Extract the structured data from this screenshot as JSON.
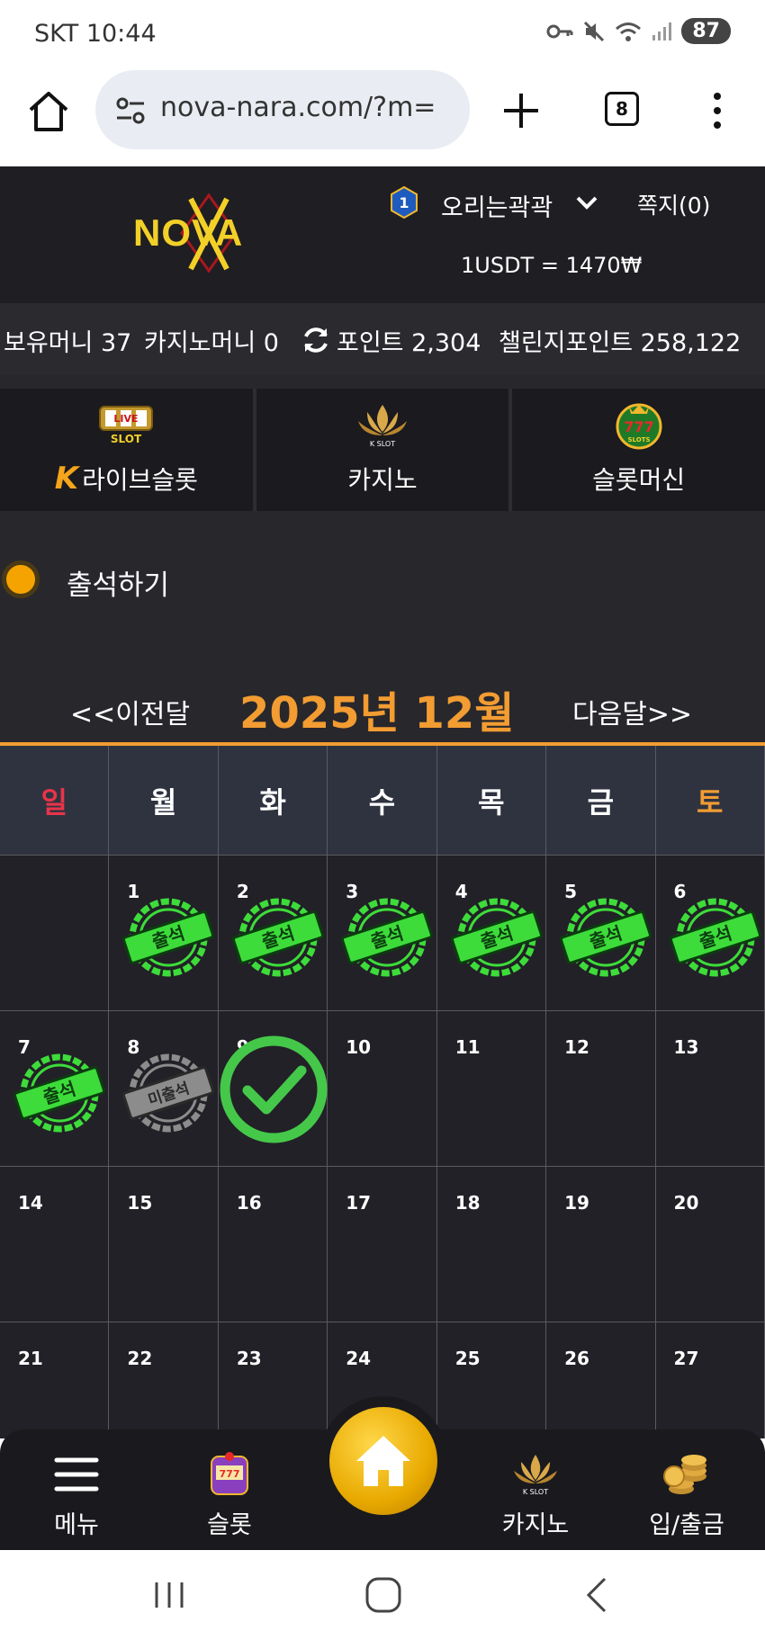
{
  "status_bar": {
    "carrier_time": "SKT 10:44",
    "battery": "87"
  },
  "browser": {
    "url": "nova-nara.com/?m=",
    "tab_count": "8"
  },
  "header": {
    "logo_text": "NOVA",
    "level": "1",
    "username": "오리는곽곽",
    "messages": "쪽지(0)",
    "rate": "1USDT = 1470₩"
  },
  "money": {
    "holding": "보유머니 37",
    "casino": "카지노머니 0",
    "points": "포인트 2,304",
    "challenge": "챌린지포인트 258,122"
  },
  "nav_tabs": [
    {
      "label": "라이브슬롯",
      "icon": "live-slot-icon",
      "icon_text": "LIVE SLOT"
    },
    {
      "label": "카지노",
      "icon": "k-slot-icon",
      "icon_text": "K SLOT"
    },
    {
      "label": "슬롯머신",
      "icon": "777-slots-icon",
      "icon_text": "777 SLOTS"
    }
  ],
  "attendance": {
    "title": "출석하기"
  },
  "calendar": {
    "prev": "<<이전달",
    "month": "2025년 12월",
    "next": "다음달>>",
    "weekdays": [
      "일",
      "월",
      "화",
      "수",
      "목",
      "금",
      "토"
    ],
    "stamp_attended": "출석",
    "stamp_missed": "미출석",
    "weeks": [
      [
        "",
        "1",
        "2",
        "3",
        "4",
        "5",
        "6"
      ],
      [
        "7",
        "8",
        "9",
        "10",
        "11",
        "12",
        "13"
      ],
      [
        "14",
        "15",
        "16",
        "17",
        "18",
        "19",
        "20"
      ],
      [
        "21",
        "22",
        "23",
        "24",
        "25",
        "26",
        "27"
      ]
    ]
  },
  "bottom_nav": {
    "menu": "메뉴",
    "slot": "슬롯",
    "casino": "카지노",
    "deposit": "입/출금"
  },
  "colors": {
    "accent": "#f29c32",
    "stamp_green": "#3ddc3a",
    "bg": "#28272c"
  }
}
